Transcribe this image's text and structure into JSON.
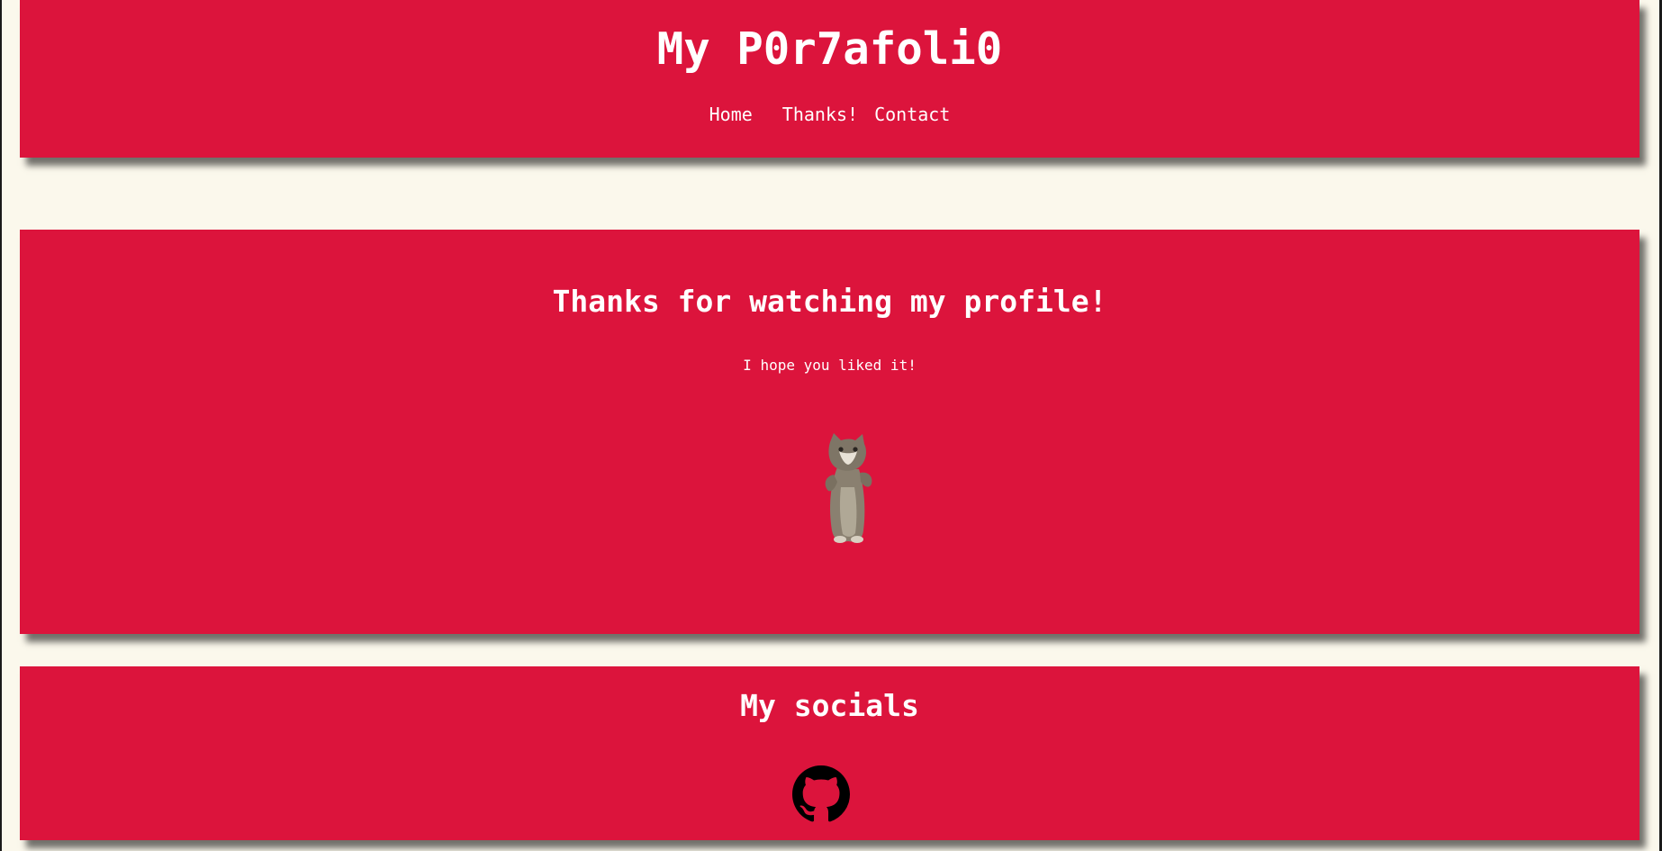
{
  "header": {
    "title": "My P0r7afoli0",
    "nav": [
      {
        "label": "Home"
      },
      {
        "label": "Thanks!"
      },
      {
        "label": "Contact"
      }
    ]
  },
  "thanks": {
    "title": "Thanks for watching my profile!",
    "subtitle": "I hope you liked it!",
    "image": "dancing-cat"
  },
  "socials": {
    "title": "My socials",
    "links": [
      {
        "icon": "github-icon"
      }
    ]
  },
  "colors": {
    "background": "#fbf8ec",
    "panel": "#dc143c",
    "text": "#ffffff"
  }
}
